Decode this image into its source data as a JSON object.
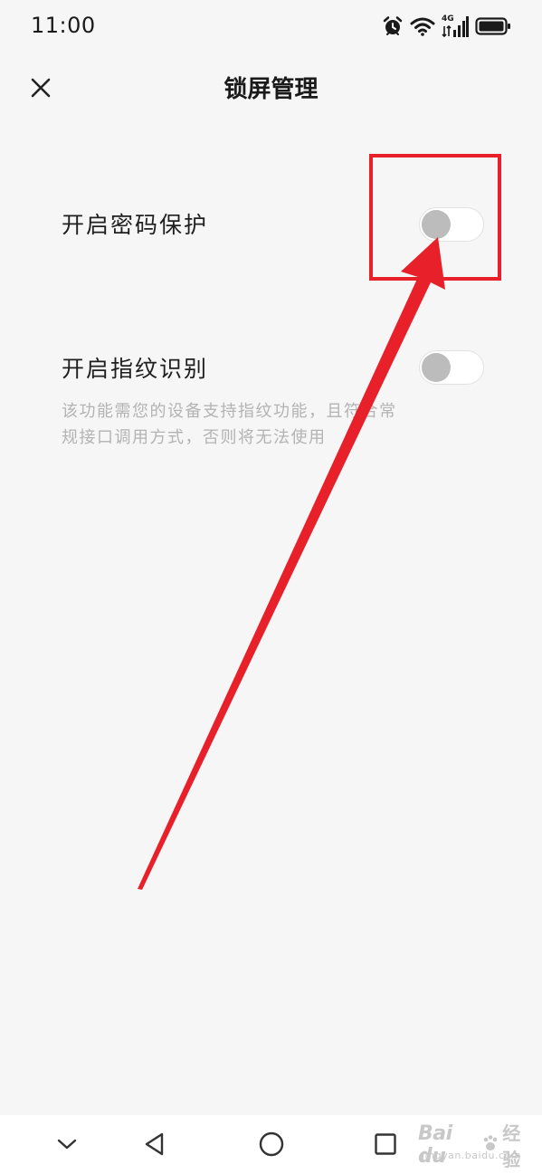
{
  "status_bar": {
    "time": "11:00",
    "network_label": "4G",
    "icons": [
      "alarm-icon",
      "wifi-icon",
      "signal-icon",
      "battery-icon"
    ]
  },
  "header": {
    "title": "锁屏管理",
    "close_icon": "close-icon"
  },
  "settings": [
    {
      "label": "开启密码保护",
      "enabled": false
    },
    {
      "label": "开启指纹识别",
      "enabled": false,
      "description": "该功能需您的设备支持指纹功能，且符合常规接口调用方式，否则将无法使用"
    }
  ],
  "annotation": {
    "color": "#e8202a"
  },
  "nav_bar": {
    "icons": [
      "chevron-down-icon",
      "back-triangle-icon",
      "home-circle-icon",
      "recents-square-icon"
    ]
  },
  "watermark": {
    "logo": "Bai du",
    "suffix": "经验",
    "url": "jingyan.baidu.com"
  },
  "colors": {
    "background": "#f6f6f6",
    "toggle_off_knob": "#bcbcbc",
    "description_text": "#b3b3b3"
  }
}
